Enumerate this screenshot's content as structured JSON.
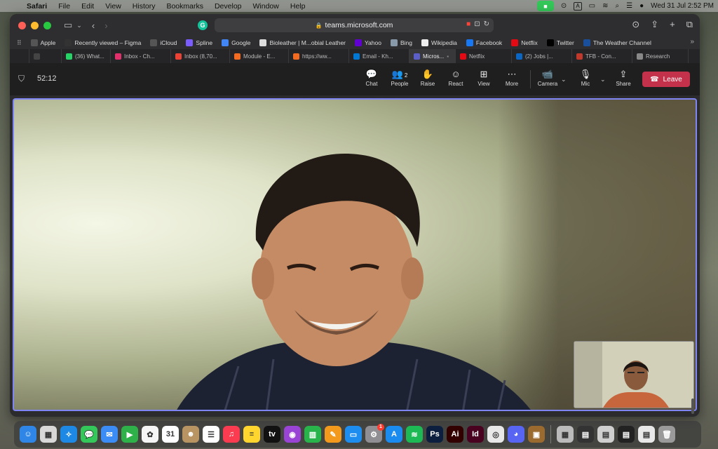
{
  "menubar": {
    "app_name": "Safari",
    "items": [
      "File",
      "Edit",
      "View",
      "History",
      "Bookmarks",
      "Develop",
      "Window",
      "Help"
    ],
    "input_indicator": "A",
    "datetime": "Wed 31 Jul  2:52 PM"
  },
  "browser": {
    "url": "teams.microsoft.com",
    "bookmarks": [
      {
        "label": "Apple",
        "icon": "apple-icon",
        "color": "#555555"
      },
      {
        "label": "Recently viewed – Figma",
        "icon": "figma-icon",
        "color": "#333333"
      },
      {
        "label": "iCloud",
        "icon": "apple-icon",
        "color": "#555555"
      },
      {
        "label": "Spline",
        "icon": "spline-icon",
        "color": "#7b5cff"
      },
      {
        "label": "Google",
        "icon": "google-icon",
        "color": "#4285f4"
      },
      {
        "label": "Bioleather | M...obial Leather",
        "icon": "page-icon",
        "color": "#dddddd"
      },
      {
        "label": "Yahoo",
        "icon": "yahoo-icon",
        "color": "#6001d2"
      },
      {
        "label": "Bing",
        "icon": "bing-icon",
        "color": "#8899aa"
      },
      {
        "label": "Wikipedia",
        "icon": "wikipedia-icon",
        "color": "#eeeeee"
      },
      {
        "label": "Facebook",
        "icon": "facebook-icon",
        "color": "#1877f2"
      },
      {
        "label": "Netflix",
        "icon": "netflix-icon",
        "color": "#e50914"
      },
      {
        "label": "Twitter",
        "icon": "x-icon",
        "color": "#000000"
      },
      {
        "label": "The Weather Channel",
        "icon": "weather-icon",
        "color": "#1a4f9c"
      }
    ],
    "tabs": [
      {
        "label": "",
        "icon": "page-icon",
        "color": "#444444"
      },
      {
        "label": "(36) What...",
        "icon": "whatsapp-icon",
        "color": "#25d366"
      },
      {
        "label": "Inbox - Ch...",
        "icon": "instagram-icon",
        "color": "#e1306c"
      },
      {
        "label": "Inbox (8,70...",
        "icon": "gmail-icon",
        "color": "#ea4335"
      },
      {
        "label": "Module - E...",
        "icon": "play-icon",
        "color": "#f26b21"
      },
      {
        "label": "https://ww...",
        "icon": "play-icon",
        "color": "#f26b21"
      },
      {
        "label": "Email - Kh...",
        "icon": "outlook-icon",
        "color": "#0078d4"
      },
      {
        "label": "Micros...",
        "icon": "teams-icon",
        "color": "#5b5fc7",
        "active": true
      },
      {
        "label": "Netflix",
        "icon": "netflix-icon",
        "color": "#e50914"
      },
      {
        "label": "(2) Jobs |...",
        "icon": "linkedin-icon",
        "color": "#0a66c2"
      },
      {
        "label": "TFB - Con...",
        "icon": "shield-icon",
        "color": "#c0392b"
      },
      {
        "label": "Research",
        "icon": "research-icon",
        "color": "#888888"
      }
    ]
  },
  "meeting": {
    "elapsed": "52:12",
    "controls": [
      {
        "id": "chat",
        "label": "Chat",
        "icon": "chat-icon",
        "glyph": "💬"
      },
      {
        "id": "people",
        "label": "People",
        "icon": "people-icon",
        "glyph": "👥",
        "count": "2"
      },
      {
        "id": "raise",
        "label": "Raise",
        "icon": "hand-icon",
        "glyph": "✋"
      },
      {
        "id": "react",
        "label": "React",
        "icon": "smile-icon",
        "glyph": "☺"
      },
      {
        "id": "view",
        "label": "View",
        "icon": "grid-icon",
        "glyph": "⊞"
      },
      {
        "id": "more",
        "label": "More",
        "icon": "more-icon",
        "glyph": "⋯"
      },
      {
        "id": "camera",
        "label": "Camera",
        "icon": "camera-icon",
        "glyph": "📹"
      },
      {
        "id": "mic",
        "label": "Mic",
        "icon": "mic-icon",
        "glyph": "🎙"
      },
      {
        "id": "share",
        "label": "Share",
        "icon": "share-icon",
        "glyph": "⇪"
      }
    ],
    "leave_label": "Leave"
  },
  "dock": {
    "apps": [
      {
        "name": "finder",
        "color": "#2f86e6",
        "glyph": "☺"
      },
      {
        "name": "launchpad",
        "color": "#d8d8d8",
        "glyph": "▦"
      },
      {
        "name": "safari",
        "color": "#1e88e5",
        "glyph": "✧"
      },
      {
        "name": "messages",
        "color": "#34c759",
        "glyph": "💬"
      },
      {
        "name": "mail",
        "color": "#3b8df5",
        "glyph": "✉"
      },
      {
        "name": "facetime",
        "color": "#2fb14a",
        "glyph": "▶"
      },
      {
        "name": "photos",
        "color": "#f5f5f5",
        "glyph": "✿"
      },
      {
        "name": "calendar",
        "color": "#ffffff",
        "glyph": "31"
      },
      {
        "name": "contacts",
        "color": "#b89463",
        "glyph": "☻"
      },
      {
        "name": "reminders",
        "color": "#ffffff",
        "glyph": "☰"
      },
      {
        "name": "music",
        "color": "#fa3b50",
        "glyph": "♫"
      },
      {
        "name": "notes",
        "color": "#ffd52e",
        "glyph": "≡"
      },
      {
        "name": "apple-tv",
        "color": "#111111",
        "glyph": "tv"
      },
      {
        "name": "podcasts",
        "color": "#9a44d6",
        "glyph": "◉"
      },
      {
        "name": "numbers",
        "color": "#28b34b",
        "glyph": "▥"
      },
      {
        "name": "pages",
        "color": "#f39a1c",
        "glyph": "✎"
      },
      {
        "name": "keynote",
        "color": "#1e8df0",
        "glyph": "▭"
      },
      {
        "name": "system-settings",
        "color": "#8e8e93",
        "glyph": "⚙",
        "badge": "1"
      },
      {
        "name": "app-store",
        "color": "#1a8cf0",
        "glyph": "A"
      },
      {
        "name": "spotify",
        "color": "#1db954",
        "glyph": "≋"
      },
      {
        "name": "photoshop",
        "color": "#0c1f3f",
        "glyph": "Ps"
      },
      {
        "name": "illustrator",
        "color": "#330000",
        "glyph": "Ai"
      },
      {
        "name": "indesign",
        "color": "#49021f",
        "glyph": "Id"
      },
      {
        "name": "chrome",
        "color": "#e8e8e8",
        "glyph": "◎"
      },
      {
        "name": "discord",
        "color": "#5865f2",
        "glyph": "◕"
      },
      {
        "name": "preview",
        "color": "#9a6a2e",
        "glyph": "▣"
      }
    ],
    "others": [
      {
        "name": "calculator",
        "color": "#bbbbbb",
        "glyph": "▦"
      },
      {
        "name": "recent-window-1",
        "color": "#333333",
        "glyph": "▤"
      },
      {
        "name": "recent-window-2",
        "color": "#cfcfcf",
        "glyph": "▤"
      },
      {
        "name": "recent-window-3",
        "color": "#222222",
        "glyph": "▤"
      },
      {
        "name": "recent-window-4",
        "color": "#e8e8e8",
        "glyph": "▤"
      },
      {
        "name": "trash",
        "color": "#9a9a9a",
        "glyph": "🗑"
      }
    ]
  }
}
